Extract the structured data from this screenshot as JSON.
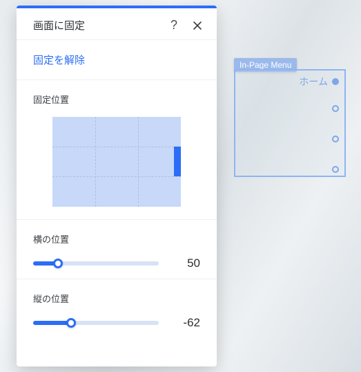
{
  "panel": {
    "title": "画面に固定",
    "unpin_label": "固定を解除",
    "position_label": "固定位置",
    "horizontal": {
      "label": "横の位置",
      "value": 50,
      "fill_pct": 20
    },
    "vertical": {
      "label": "縦の位置",
      "value": -62,
      "fill_pct": 30
    }
  },
  "widget": {
    "badge": "In-Page Menu",
    "items": [
      {
        "label": "ホーム",
        "active": true
      },
      {
        "label": "",
        "active": false
      },
      {
        "label": "",
        "active": false
      },
      {
        "label": "",
        "active": false
      }
    ]
  }
}
